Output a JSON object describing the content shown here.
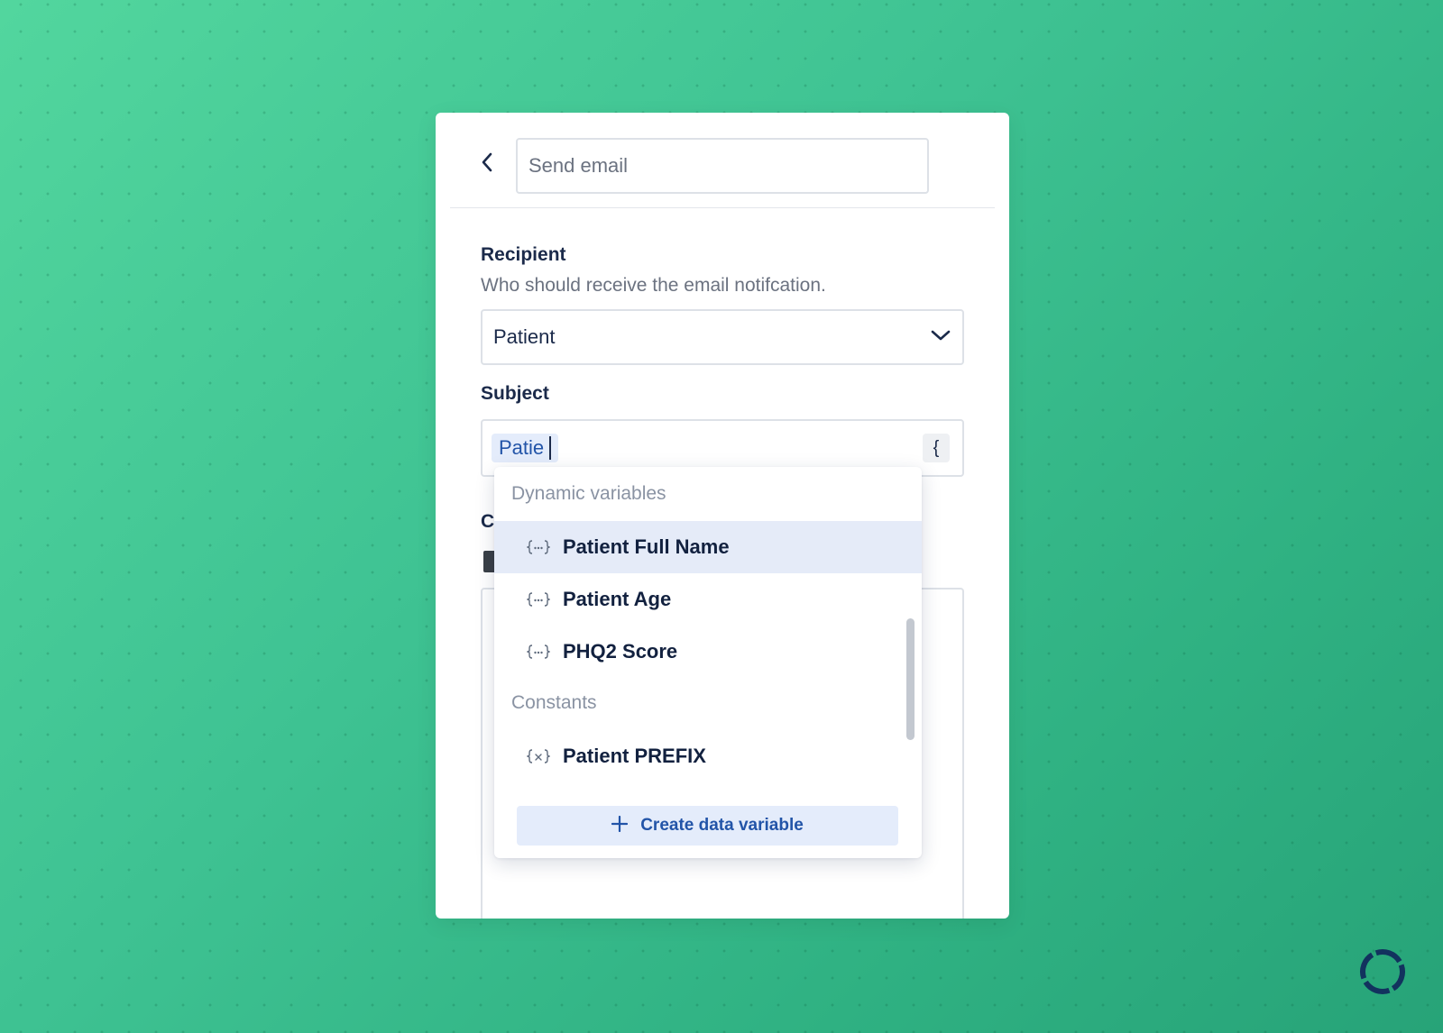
{
  "header": {
    "back_icon": "chevron-left-icon",
    "name_placeholder": "Send email"
  },
  "recipient": {
    "label": "Recipient",
    "help": "Who should receive the email notifcation.",
    "selected": "Patient",
    "dropdown_icon": "chevron-down-icon"
  },
  "subject": {
    "label": "Subject",
    "token_text": "Patie",
    "insert_variable_glyph": "{"
  },
  "content": {
    "label_visible": "C"
  },
  "variable_menu": {
    "groups": [
      {
        "title": "Dynamic variables",
        "icon": "dynamic-variable-icon",
        "items": [
          "Patient Full Name",
          "Patient Age",
          "PHQ2 Score"
        ]
      },
      {
        "title": "Constants",
        "icon": "constant-variable-icon",
        "items": [
          "Patient PREFIX"
        ]
      }
    ],
    "highlighted_item": "Patient Full Name",
    "create_label": "Create data variable"
  },
  "colors": {
    "background": "#3fc393",
    "accent": "#2254a8",
    "highlight": "#e5ebf8",
    "text_dark": "#1b2a4a",
    "logo": "#12325e"
  }
}
